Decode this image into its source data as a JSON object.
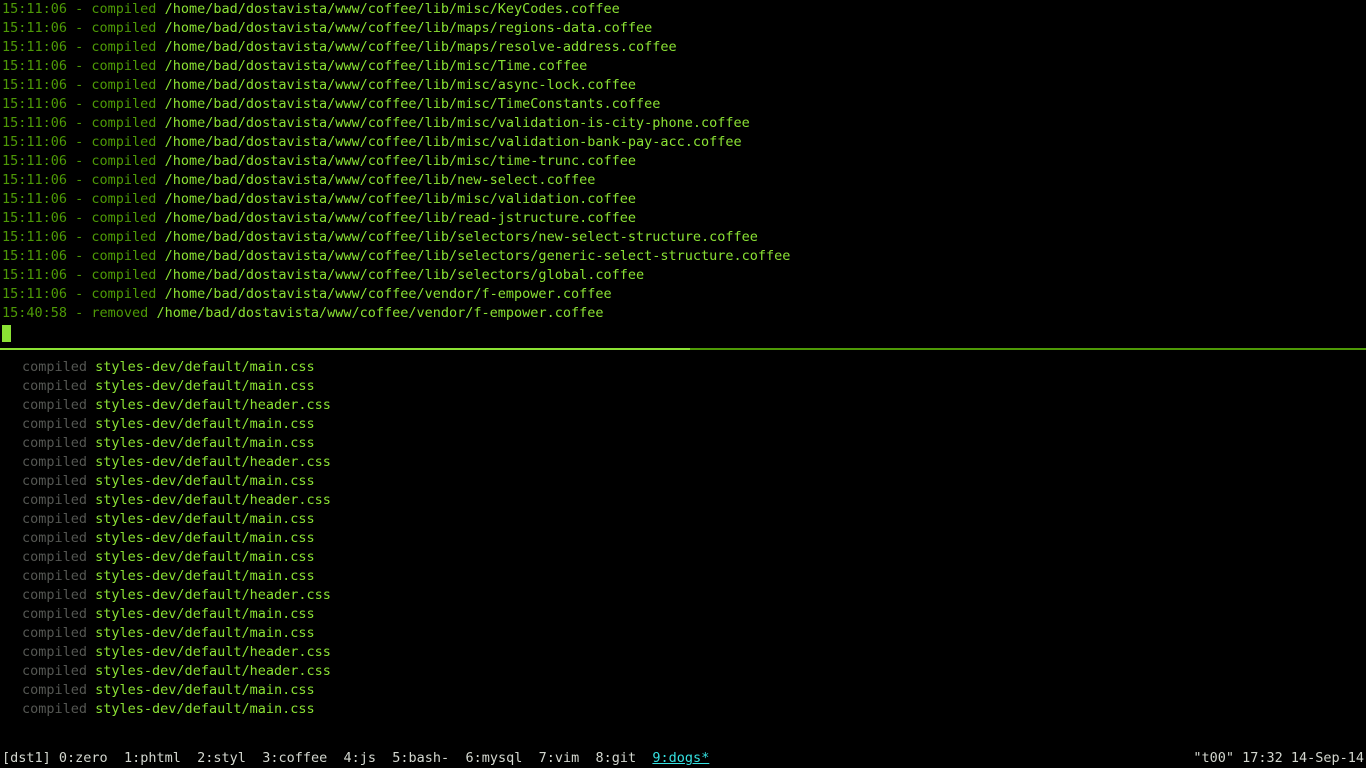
{
  "top_pane": {
    "lines": [
      {
        "ts_action": "15:11:06 - compiled ",
        "path": "/home/bad/dostavista/www/coffee/lib/misc/KeyCodes.coffee"
      },
      {
        "ts_action": "15:11:06 - compiled ",
        "path": "/home/bad/dostavista/www/coffee/lib/maps/regions-data.coffee"
      },
      {
        "ts_action": "15:11:06 - compiled ",
        "path": "/home/bad/dostavista/www/coffee/lib/maps/resolve-address.coffee"
      },
      {
        "ts_action": "15:11:06 - compiled ",
        "path": "/home/bad/dostavista/www/coffee/lib/misc/Time.coffee"
      },
      {
        "ts_action": "15:11:06 - compiled ",
        "path": "/home/bad/dostavista/www/coffee/lib/misc/async-lock.coffee"
      },
      {
        "ts_action": "15:11:06 - compiled ",
        "path": "/home/bad/dostavista/www/coffee/lib/misc/TimeConstants.coffee"
      },
      {
        "ts_action": "15:11:06 - compiled ",
        "path": "/home/bad/dostavista/www/coffee/lib/misc/validation-is-city-phone.coffee"
      },
      {
        "ts_action": "15:11:06 - compiled ",
        "path": "/home/bad/dostavista/www/coffee/lib/misc/validation-bank-pay-acc.coffee"
      },
      {
        "ts_action": "15:11:06 - compiled ",
        "path": "/home/bad/dostavista/www/coffee/lib/misc/time-trunc.coffee"
      },
      {
        "ts_action": "15:11:06 - compiled ",
        "path": "/home/bad/dostavista/www/coffee/lib/new-select.coffee"
      },
      {
        "ts_action": "15:11:06 - compiled ",
        "path": "/home/bad/dostavista/www/coffee/lib/misc/validation.coffee"
      },
      {
        "ts_action": "15:11:06 - compiled ",
        "path": "/home/bad/dostavista/www/coffee/lib/read-jstructure.coffee"
      },
      {
        "ts_action": "15:11:06 - compiled ",
        "path": "/home/bad/dostavista/www/coffee/lib/selectors/new-select-structure.coffee"
      },
      {
        "ts_action": "15:11:06 - compiled ",
        "path": "/home/bad/dostavista/www/coffee/lib/selectors/generic-select-structure.coffee"
      },
      {
        "ts_action": "15:11:06 - compiled ",
        "path": "/home/bad/dostavista/www/coffee/lib/selectors/global.coffee"
      },
      {
        "ts_action": "15:11:06 - compiled ",
        "path": "/home/bad/dostavista/www/coffee/vendor/f-empower.coffee"
      },
      {
        "ts_action": "15:40:58 - removed ",
        "path": "/home/bad/dostavista/www/coffee/vendor/f-empower.coffee"
      }
    ]
  },
  "bottom_pane": {
    "lines": [
      {
        "label": "compiled ",
        "path": "styles-dev/default/main.css"
      },
      {
        "label": "compiled ",
        "path": "styles-dev/default/main.css"
      },
      {
        "label": "compiled ",
        "path": "styles-dev/default/header.css"
      },
      {
        "label": "compiled ",
        "path": "styles-dev/default/main.css"
      },
      {
        "label": "compiled ",
        "path": "styles-dev/default/main.css"
      },
      {
        "label": "compiled ",
        "path": "styles-dev/default/header.css"
      },
      {
        "label": "compiled ",
        "path": "styles-dev/default/main.css"
      },
      {
        "label": "compiled ",
        "path": "styles-dev/default/header.css"
      },
      {
        "label": "compiled ",
        "path": "styles-dev/default/main.css"
      },
      {
        "label": "compiled ",
        "path": "styles-dev/default/main.css"
      },
      {
        "label": "compiled ",
        "path": "styles-dev/default/main.css"
      },
      {
        "label": "compiled ",
        "path": "styles-dev/default/main.css"
      },
      {
        "label": "compiled ",
        "path": "styles-dev/default/header.css"
      },
      {
        "label": "compiled ",
        "path": "styles-dev/default/main.css"
      },
      {
        "label": "compiled ",
        "path": "styles-dev/default/main.css"
      },
      {
        "label": "compiled ",
        "path": "styles-dev/default/header.css"
      },
      {
        "label": "compiled ",
        "path": "styles-dev/default/header.css"
      },
      {
        "label": "compiled ",
        "path": "styles-dev/default/main.css"
      },
      {
        "label": "compiled ",
        "path": "styles-dev/default/main.css"
      }
    ]
  },
  "statusbar": {
    "session": "[dst1]",
    "windows": [
      {
        "idx": "0",
        "name": "zero",
        "flags": "",
        "active": false
      },
      {
        "idx": "1",
        "name": "phtml",
        "flags": "",
        "active": false
      },
      {
        "idx": "2",
        "name": "styl",
        "flags": "",
        "active": false
      },
      {
        "idx": "3",
        "name": "coffee",
        "flags": "",
        "active": false
      },
      {
        "idx": "4",
        "name": "js",
        "flags": "",
        "active": false
      },
      {
        "idx": "5",
        "name": "bash-",
        "flags": "",
        "active": false
      },
      {
        "idx": "6",
        "name": "mysql",
        "flags": "",
        "active": false
      },
      {
        "idx": "7",
        "name": "vim",
        "flags": "",
        "active": false
      },
      {
        "idx": "8",
        "name": "git",
        "flags": "",
        "active": false
      },
      {
        "idx": "9",
        "name": "dogs",
        "flags": "*",
        "active": true
      }
    ],
    "right": "\"t00\" 17:32 14-Sep-14"
  }
}
